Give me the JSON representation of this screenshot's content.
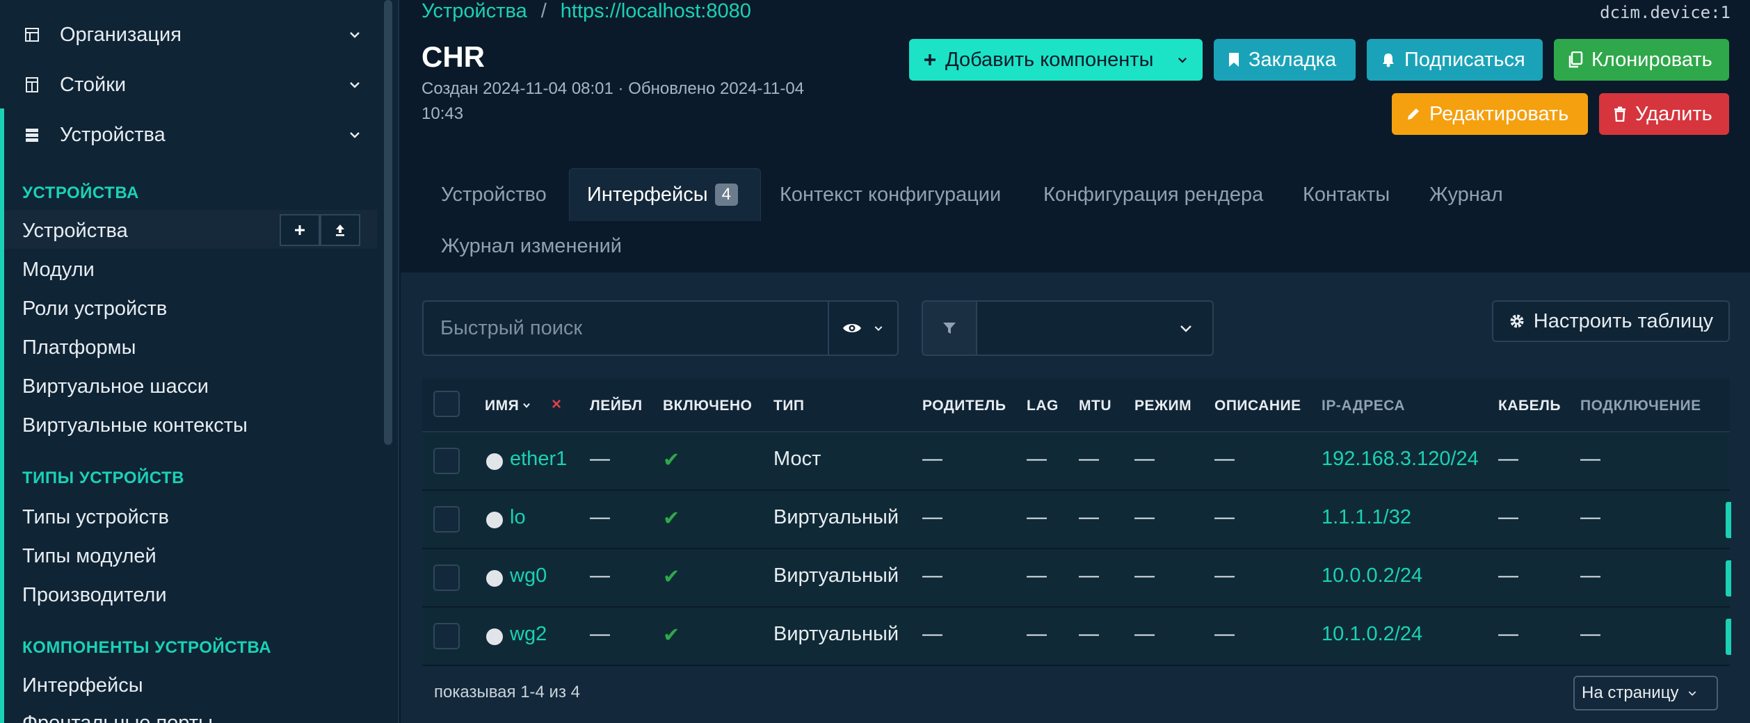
{
  "sidebar": {
    "groups": [
      {
        "label": "Организация",
        "icon": "organization-icon"
      },
      {
        "label": "Стойки",
        "icon": "rack-icon"
      },
      {
        "label": "Устройства",
        "icon": "server-icon"
      }
    ],
    "sections": [
      {
        "title": "УСТРОЙСТВА",
        "items": [
          "Устройства",
          "Модули",
          "Роли устройств",
          "Платформы",
          "Виртуальное шасси",
          "Виртуальные контексты"
        ]
      },
      {
        "title": "ТИПЫ УСТРОЙСТВ",
        "items": [
          "Типы устройств",
          "Типы модулей",
          "Производители"
        ]
      },
      {
        "title": "КОМПОНЕНТЫ УСТРОЙСТВА",
        "items": [
          "Интерфейсы",
          "Фронтальные порты"
        ]
      }
    ],
    "active_item": "Устройства"
  },
  "header": {
    "breadcrumb": [
      "Устройства",
      "https://localhost:8080"
    ],
    "breadcrumb_sep": "/",
    "object_id": "dcim.device:1",
    "title": "CHR",
    "subtitle": "Создан 2024-11-04 08:01 · Обновлено 2024-11-04 10:43"
  },
  "actions": {
    "add_components": "Добавить компоненты",
    "bookmark": "Закладка",
    "subscribe": "Подписаться",
    "clone": "Клонировать",
    "edit": "Редактировать",
    "delete": "Удалить"
  },
  "tabs": [
    {
      "label": "Устройство"
    },
    {
      "label": "Интерфейсы",
      "badge": "4",
      "active": true
    },
    {
      "label": "Контекст конфигурации"
    },
    {
      "label": "Конфигурация рендера"
    },
    {
      "label": "Контакты"
    },
    {
      "label": "Журнал"
    },
    {
      "label": "Журнал изменений"
    }
  ],
  "toolbar": {
    "search_placeholder": "Быстрый поиск",
    "filter_value": "",
    "configure_table": "Настроить таблицу"
  },
  "table": {
    "columns": [
      "ИМЯ",
      "ЛЕЙБЛ",
      "ВКЛЮЧЕНО",
      "ТИП",
      "РОДИТЕЛЬ",
      "LAG",
      "MTU",
      "РЕЖИМ",
      "ОПИСАНИЕ",
      "IP-АДРЕСА",
      "КАБЕЛЬ",
      "ПОДКЛЮЧЕНИЕ"
    ],
    "sort_clear": "×",
    "rows": [
      {
        "name": "ether1",
        "label": "—",
        "enabled": "✔",
        "type": "Мост",
        "parent": "—",
        "lag": "—",
        "mtu": "—",
        "mode": "—",
        "description": "—",
        "ip": "192.168.3.120/24",
        "cable": "—",
        "connection": "—"
      },
      {
        "name": "lo",
        "label": "—",
        "enabled": "✔",
        "type": "Виртуальный",
        "parent": "—",
        "lag": "—",
        "mtu": "—",
        "mode": "—",
        "description": "—",
        "ip": "1.1.1.1/32",
        "cable": "—",
        "connection": "—"
      },
      {
        "name": "wg0",
        "label": "—",
        "enabled": "✔",
        "type": "Виртуальный",
        "parent": "—",
        "lag": "—",
        "mtu": "—",
        "mode": "—",
        "description": "—",
        "ip": "10.0.0.2/24",
        "cable": "—",
        "connection": "—"
      },
      {
        "name": "wg2",
        "label": "—",
        "enabled": "✔",
        "type": "Виртуальный",
        "parent": "—",
        "lag": "—",
        "mtu": "—",
        "mode": "—",
        "description": "—",
        "ip": "10.1.0.2/24",
        "cable": "—",
        "connection": "—"
      }
    ]
  },
  "footer": {
    "showing": "показывая 1-4 из 4",
    "per_page": "На страницу"
  },
  "colors": {
    "accent": "#1bd1b5",
    "background": "#0b1a2a",
    "add": "#1ce3c6",
    "info": "#1aa3b8",
    "success": "#2ea84a",
    "warning": "#f5a00f",
    "danger": "#d6353e"
  }
}
